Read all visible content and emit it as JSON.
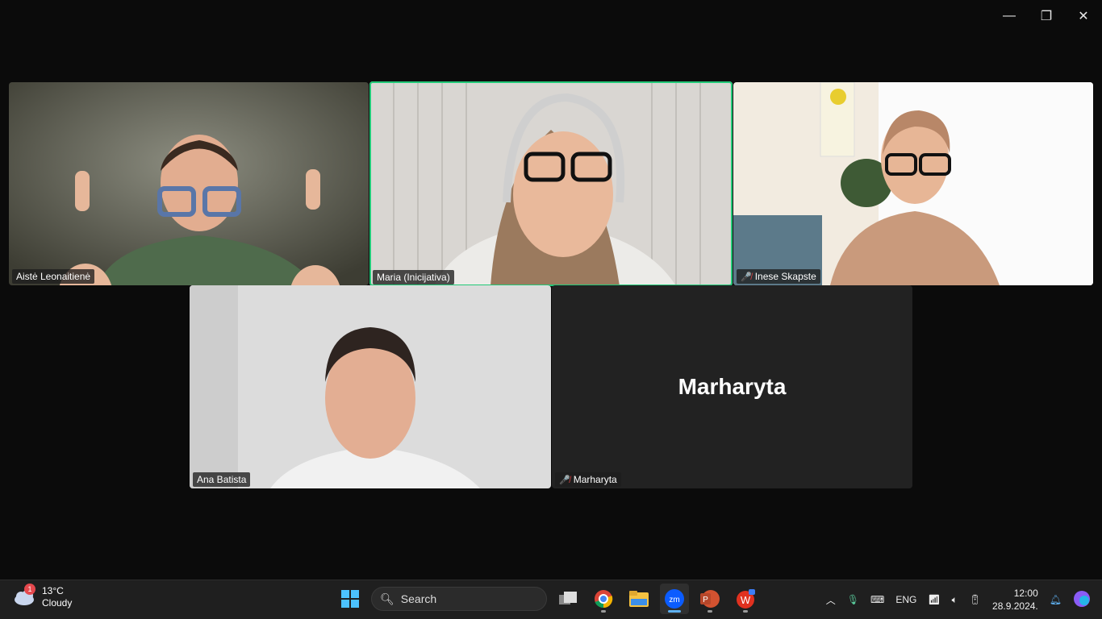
{
  "window": {
    "minimize": "—",
    "restore": "❐",
    "close": "✕"
  },
  "participants": [
    {
      "name": "Aistė Leonaitienė",
      "muted": false,
      "active": false
    },
    {
      "name": "Maria (Inicijativa)",
      "muted": false,
      "active": true
    },
    {
      "name": "Inese Skapste",
      "muted": true,
      "active": false
    },
    {
      "name": "Ana Batista",
      "muted": false,
      "active": false
    },
    {
      "name": "Marharyta",
      "muted": true,
      "active": false,
      "video_off": true
    }
  ],
  "taskbar": {
    "weather": {
      "temp": "13°C",
      "desc": "Cloudy",
      "badge": "1"
    },
    "search_label": "Search",
    "lang": "ENG",
    "time": "12:00",
    "date": "28.9.2024."
  },
  "colors": {
    "active_border": "#22c978",
    "mute": "#e04343"
  }
}
